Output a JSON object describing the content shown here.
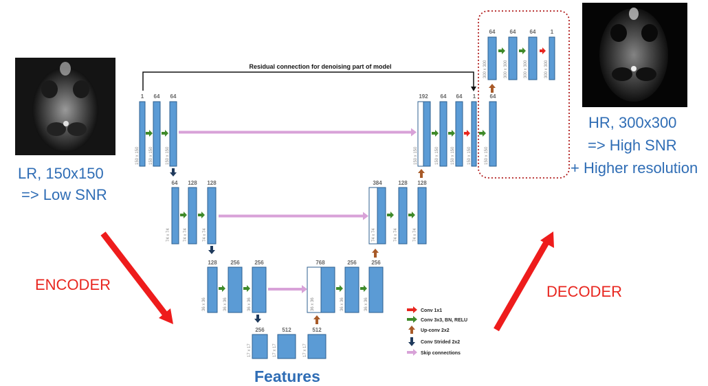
{
  "labels": {
    "lr_line1": "LR, 150x150",
    "lr_line2": "=> Low SNR",
    "hr_line1": "HR, 300x300",
    "hr_line2": "=> High SNR",
    "hr_line3": "+ Higher resolution",
    "encoder": "ENCODER",
    "decoder": "DECODER",
    "features": "Features",
    "residual": "Residual connection for denoising part of model"
  },
  "colors": {
    "block": "#5b9bd5",
    "block_border": "#2e5f8f",
    "conv1x1": "#e8261f",
    "conv3x3": "#3f8a2a",
    "upconv": "#a85a28",
    "strided": "#1f3a5c",
    "skip": "#d8a2d8",
    "big_arrow": "#ee1c1c",
    "dotted_box": "#b01c1c"
  },
  "legend": [
    {
      "icon": "conv1x1",
      "label": "Conv 1x1"
    },
    {
      "icon": "conv3x3",
      "label": "Conv 3x3, BN, RELU"
    },
    {
      "icon": "upconv",
      "label": "Up-conv 2x2"
    },
    {
      "icon": "strided",
      "label": "Conv Strided 2x2"
    },
    {
      "icon": "skip",
      "label": "Skip connections"
    }
  ],
  "layers": {
    "enc1": {
      "channels": [
        "1",
        "64",
        "64"
      ],
      "size": "150 x 150"
    },
    "enc2": {
      "channels": [
        "64",
        "128",
        "128"
      ],
      "size": "74 x 74"
    },
    "enc3": {
      "channels": [
        "128",
        "256",
        "256"
      ],
      "size": "36 x 36"
    },
    "bottleneck": {
      "channels": [
        "256",
        "512",
        "512"
      ],
      "size": "17 x 17"
    },
    "dec3": {
      "channels": [
        "768",
        "256",
        "256"
      ],
      "size": "36 x 36"
    },
    "dec2": {
      "channels": [
        "384",
        "128",
        "128"
      ],
      "size": "74 x 74"
    },
    "dec1": {
      "channels": [
        "192",
        "64",
        "64",
        "1",
        "64"
      ],
      "size": "150 x 150"
    },
    "sr": {
      "channels": [
        "64",
        "64",
        "64",
        "1"
      ],
      "size": "300 x 300"
    }
  }
}
